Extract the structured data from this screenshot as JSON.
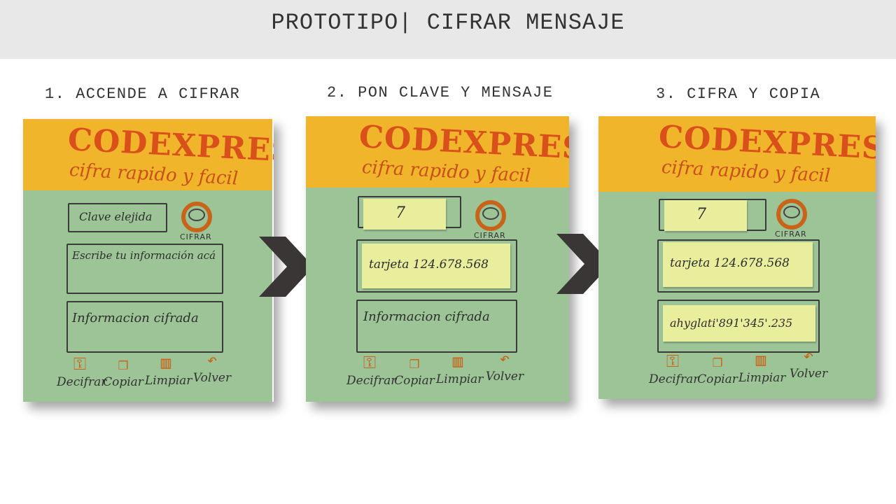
{
  "slide": {
    "title": "PROTOTIPO| CIFRAR MENSAJE"
  },
  "steps": [
    {
      "title": "1. ACCENDE A CIFRAR",
      "logo": "CODEXPRESS",
      "tagline": "cifra rapido y facil",
      "key_field": "Clave elejida",
      "cifrar_label": "CIFRAR",
      "message_field": "Escribe tu información acá",
      "encrypted_field": "Informacion cifrada",
      "toolbar": [
        "Decifrar",
        "Copiar",
        "Limpiar",
        "Volver"
      ]
    },
    {
      "title": "2. PON CLAVE Y MENSAJE",
      "logo": "CODEXPRESS",
      "tagline": "cifra rapido y facil",
      "key_value": "7",
      "cifrar_label": "CIFRAR",
      "message_value": "tarjeta 124.678.568",
      "encrypted_field": "Informacion cifrada",
      "toolbar": [
        "Decifrar",
        "Copiar",
        "Limpiar",
        "Volver"
      ]
    },
    {
      "title": "3. CIFRA Y COPIA",
      "logo": "CODEXPRESS",
      "tagline": "cifra rapido y facil",
      "key_value": "7",
      "cifrar_label": "CIFRAR",
      "message_value": "tarjeta 124.678.568",
      "encrypted_value": "ahyglati'891'345'.235",
      "toolbar": [
        "Decifrar",
        "Copiar",
        "Limpiar",
        "Volver"
      ]
    }
  ],
  "icons": [
    "key-icon",
    "copy-icon",
    "trash-icon",
    "undo-icon",
    "chevron-right-icon"
  ],
  "colors": {
    "banner": "#f0b52b",
    "paper_green": "#9cc496",
    "logo_orange": "#d9501b",
    "postit": "#e8ee9c",
    "arrow": "#3a3636",
    "header_band": "#e8e8e8"
  }
}
